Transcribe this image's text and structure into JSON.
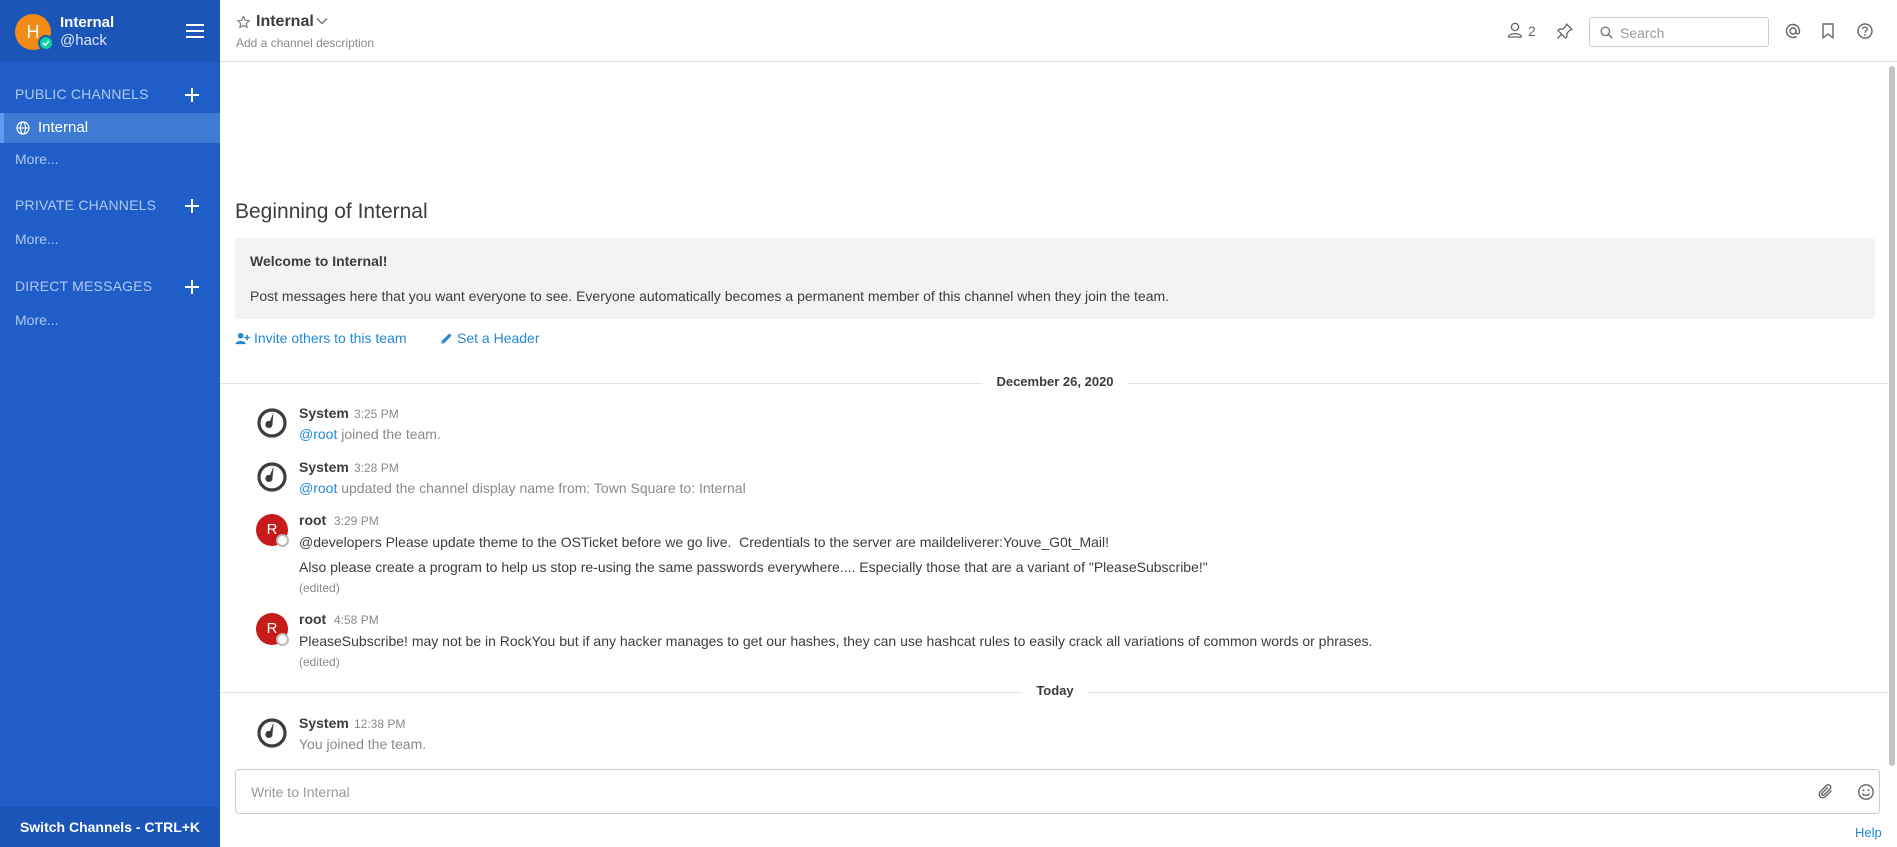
{
  "sidebar": {
    "avatar_initial": "H",
    "team_name": "Internal",
    "username": "@hack",
    "public_channels_title": "PUBLIC CHANNELS",
    "active_channel": "Internal",
    "public_more": "More...",
    "private_channels_title": "PRIVATE CHANNELS",
    "private_more": "More...",
    "direct_messages_title": "DIRECT MESSAGES",
    "dm_more": "More...",
    "switch_channels": "Switch Channels - CTRL+K"
  },
  "header": {
    "channel_name": "Internal",
    "description": "Add a channel description",
    "member_count": "2",
    "search_placeholder": "Search"
  },
  "intro": {
    "title": "Beginning of Internal",
    "welcome_title": "Welcome to Internal!",
    "welcome_text": "Post messages here that you want everyone to see. Everyone automatically becomes a permanent member of this channel when they join the team.",
    "invite_link": "Invite others to this team",
    "header_link": "Set a Header"
  },
  "date_separators": [
    "December 26, 2020",
    "Today"
  ],
  "posts": [
    {
      "author": "System",
      "time": "3:25 PM",
      "mention": "@root",
      "text": " joined the team."
    },
    {
      "author": "System",
      "time": "3:28 PM",
      "mention": "@root",
      "text": " updated the channel display name from: Town Square to: Internal"
    },
    {
      "author": "root",
      "avatar_initial": "R",
      "time": "3:29 PM",
      "line1": "@developers Please update theme to the OSTicket before we go live.  Credentials to the server are maildeliverer:Youve_G0t_Mail!",
      "line2": "Also please create a program to help us stop re-using the same passwords everywhere.... Especially those that are a variant of \"PleaseSubscribe!\"",
      "edited": "(edited)"
    },
    {
      "author": "root",
      "avatar_initial": "R",
      "time": "4:58 PM",
      "line1": "PleaseSubscribe! may not be in RockYou but if any hacker manages to get our hashes, they can use hashcat rules to easily crack all variations of common words or phrases.",
      "edited": "(edited)"
    },
    {
      "author": "System",
      "time": "12:38 PM",
      "you": "You",
      "text": " joined the team."
    }
  ],
  "composer": {
    "placeholder": "Write to Internal",
    "help": "Help"
  },
  "colors": {
    "sidebar_bg": "#1f5ec9",
    "link": "#2389d7",
    "avatar_h": "#f28b16",
    "avatar_r": "#c71a1a"
  }
}
